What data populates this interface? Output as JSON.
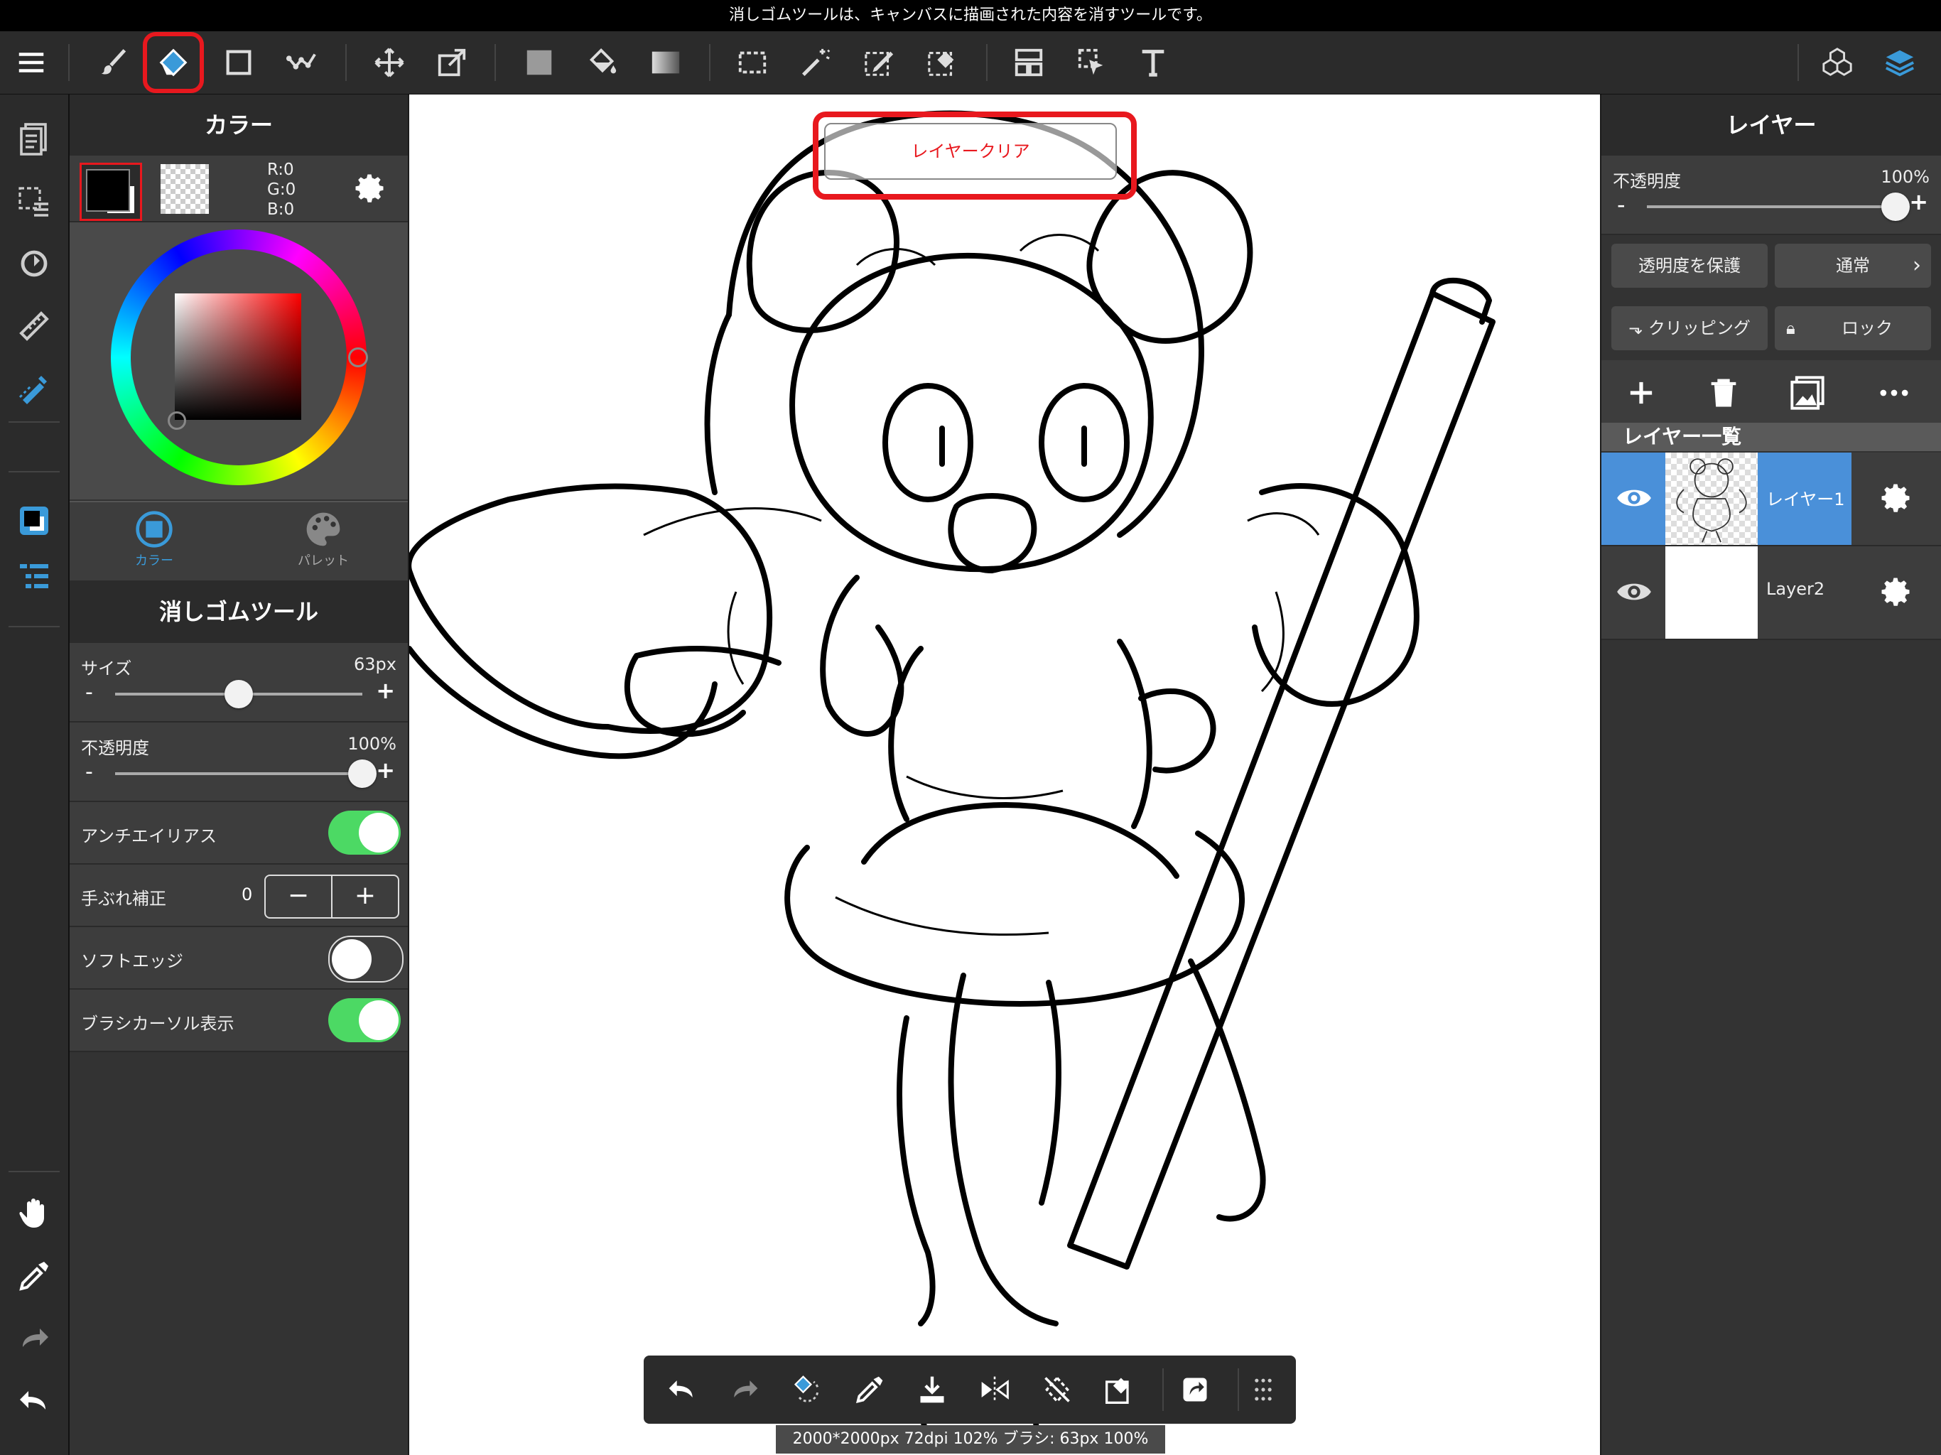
{
  "status_bar": {
    "message": "消しゴムツールは、キャンバスに描画された内容を消すツールです。"
  },
  "toolbar": {
    "icons": [
      "menu-icon",
      "brush-icon",
      "eraser-icon",
      "rect-fill-icon",
      "dot-icon",
      "move-icon",
      "transform-icon",
      "fill-color-icon",
      "bucket-icon",
      "gradient-icon",
      "select-rect-icon",
      "magic-wand-icon",
      "select-pen-icon",
      "select-eraser-icon",
      "frame-divider-icon",
      "operation-icon",
      "text-icon",
      "3d-icon",
      "layers-icon"
    ],
    "selected_tool": "eraser"
  },
  "color_panel": {
    "title": "カラー",
    "rgb": {
      "r": "R:0",
      "g": "G:0",
      "b": "B:0"
    },
    "tab_color": "カラー",
    "tab_palette": "パレット",
    "accent": "#3a8fd8"
  },
  "tool_panel": {
    "title": "消しゴムツール",
    "size_label": "サイズ",
    "size_value": "63px",
    "size_fraction": 0.5,
    "opacity_label": "不透明度",
    "opacity_value": "100%",
    "opacity_fraction": 1.0,
    "antialias_label": "アンチエイリアス",
    "antialias_on": true,
    "stabilizer_label": "手ぶれ補正",
    "stabilizer_value": "0",
    "soft_edge_label": "ソフトエッジ",
    "soft_edge_on": false,
    "brush_cursor_label": "ブラシカーソル表示",
    "brush_cursor_on": true,
    "minus": "-",
    "plus": "+"
  },
  "canvas": {
    "overlay_button": "レイヤークリア",
    "highlight_color": "#e8181e"
  },
  "layer_panel": {
    "title": "レイヤー",
    "opacity_label": "不透明度",
    "opacity_value": "100%",
    "opacity_fraction": 1.0,
    "minus": "-",
    "plus": "+",
    "protect_alpha": "透明度を保護",
    "blend_mode": "通常",
    "clipping": "クリッピング",
    "lock": "ロック",
    "list_header": "レイヤー一覧",
    "layers": [
      {
        "name": "レイヤー1",
        "selected": true
      },
      {
        "name": "Layer2",
        "selected": false
      }
    ]
  },
  "bottom_toolbar": {
    "icons": [
      "undo-icon",
      "redo-icon",
      "eraser-rotate-icon",
      "eyedropper-icon",
      "save-icon",
      "flip-icon",
      "rotate-reset-icon",
      "clear-icon",
      "share-icon",
      "grid-dots-icon"
    ],
    "info": "2000*2000px 72dpi 102% ブラシ: 63px 100%"
  }
}
